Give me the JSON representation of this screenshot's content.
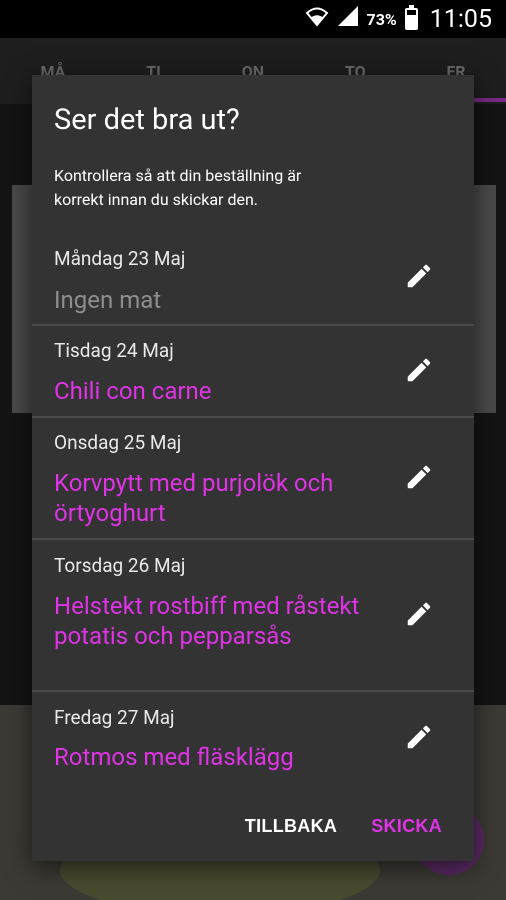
{
  "status_bar": {
    "battery_percent": "73%",
    "battery_level": 0.73,
    "time": "11:05",
    "icons": [
      "wifi-icon",
      "signal-icon",
      "battery-icon"
    ]
  },
  "background": {
    "tabs": [
      "MÅ",
      "TI",
      "ON",
      "TO",
      "FR"
    ]
  },
  "dialog": {
    "title": "Ser det bra ut?",
    "message": "Kontrollera så att din beställning är korrekt innan du skickar den.",
    "entries": [
      {
        "day": "Måndag 23 Maj",
        "meal": "Ingen mat",
        "empty": true
      },
      {
        "day": "Tisdag 24 Maj",
        "meal": "Chili con carne",
        "empty": false
      },
      {
        "day": "Onsdag 25 Maj",
        "meal": "Korvpytt med purjolök och örtyoghurt",
        "empty": false
      },
      {
        "day": "Torsdag 26 Maj",
        "meal": "Helstekt rostbiff med råstekt potatis och pepparsås",
        "empty": false
      },
      {
        "day": "Fredag 27 Maj",
        "meal": "Rotmos med fläsklägg",
        "empty": false
      }
    ],
    "actions": {
      "back_label": "TILLBAKA",
      "send_label": "SKICKA"
    }
  },
  "colors": {
    "accent": "#e033e6",
    "dialog_bg": "#333333",
    "muted_text": "#8e8e8e"
  }
}
